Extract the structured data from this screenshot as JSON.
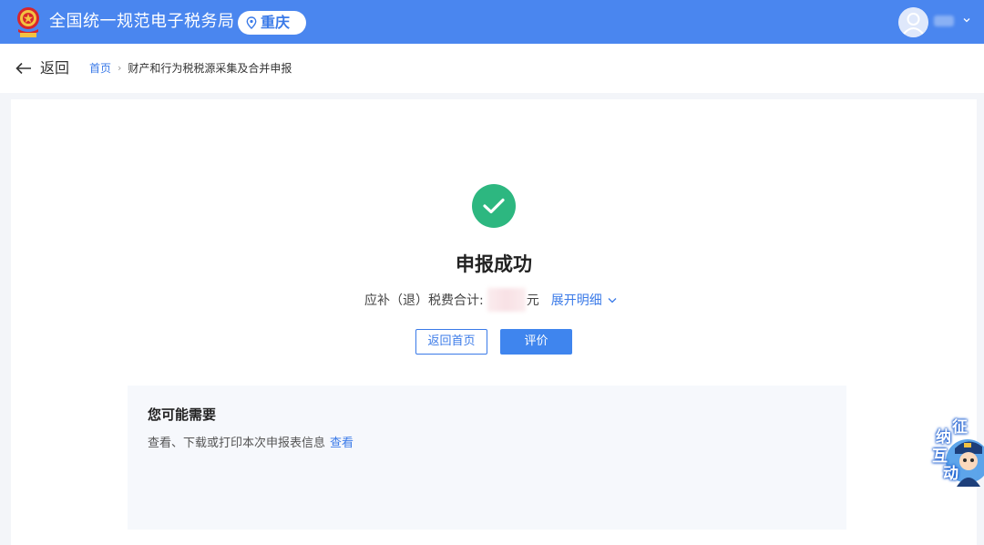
{
  "header": {
    "app_title": "全国统一规范电子税务局",
    "region": "重庆",
    "brand_color": "#4a86ef"
  },
  "topbar": {
    "back_label": "返回",
    "breadcrumb": {
      "home": "首页",
      "separator": "›",
      "current": "财产和行为税税源采集及合并申报"
    }
  },
  "result": {
    "title": "申报成功",
    "summary_label": "应补（退）税费合计:",
    "currency": "元",
    "expand_label": "展开明细",
    "success_color": "#2db780"
  },
  "actions": {
    "home_button": "返回首页",
    "rate_button": "评价"
  },
  "need": {
    "title": "您可能需要",
    "text": "查看、下载或打印本次申报表信息",
    "link": "查看"
  },
  "assistant": {
    "chars": [
      "征",
      "纳",
      "互",
      "动"
    ]
  },
  "icons": {
    "logo": "tax-emblem-icon",
    "region": "location-pin-icon",
    "avatar": "user-avatar-icon",
    "dropdown": "chevron-down-icon",
    "back": "arrow-left-icon",
    "success": "check-circle-icon"
  }
}
